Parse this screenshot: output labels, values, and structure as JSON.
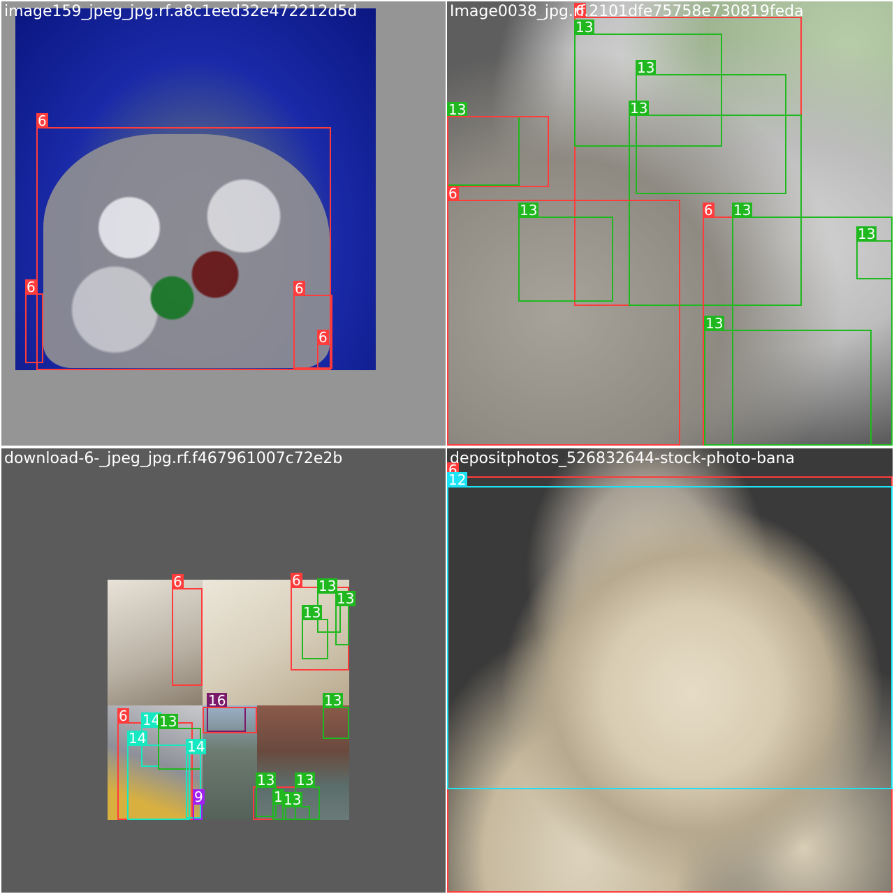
{
  "colors": {
    "class_6": "#ff3b3b",
    "class_9": "#a020f0",
    "class_12": "#19e3f5",
    "class_13": "#1fb81f",
    "class_14": "#16e8c2",
    "class_16": "#7a1a6b",
    "mosaic_bg_top": "#959595",
    "mosaic_bg_bottom": "#5b5b5b"
  },
  "tiles": [
    {
      "filename": "image159_jpeg_jpg.rf.a8c1eed32e472212d5d",
      "labels": [
        "6",
        "6",
        "6",
        "6"
      ]
    },
    {
      "filename": "Image0038_jpg.rf.2101dfe75758e730819feda",
      "labels": [
        "6",
        "13",
        "13",
        "13",
        "13",
        "6",
        "13",
        "6",
        "13",
        "13",
        "13"
      ]
    },
    {
      "filename": "download-6-_jpeg_jpg.rf.f467961007c72e2b",
      "labels": [
        "6",
        "6",
        "13",
        "13",
        "13",
        "16",
        "13",
        "6",
        "14",
        "13",
        "14",
        "14",
        "9",
        "13",
        "13",
        "1",
        "13"
      ]
    },
    {
      "filename": "depositphotos_526832644-stock-photo-bana",
      "labels": [
        "6",
        "12"
      ]
    }
  ]
}
